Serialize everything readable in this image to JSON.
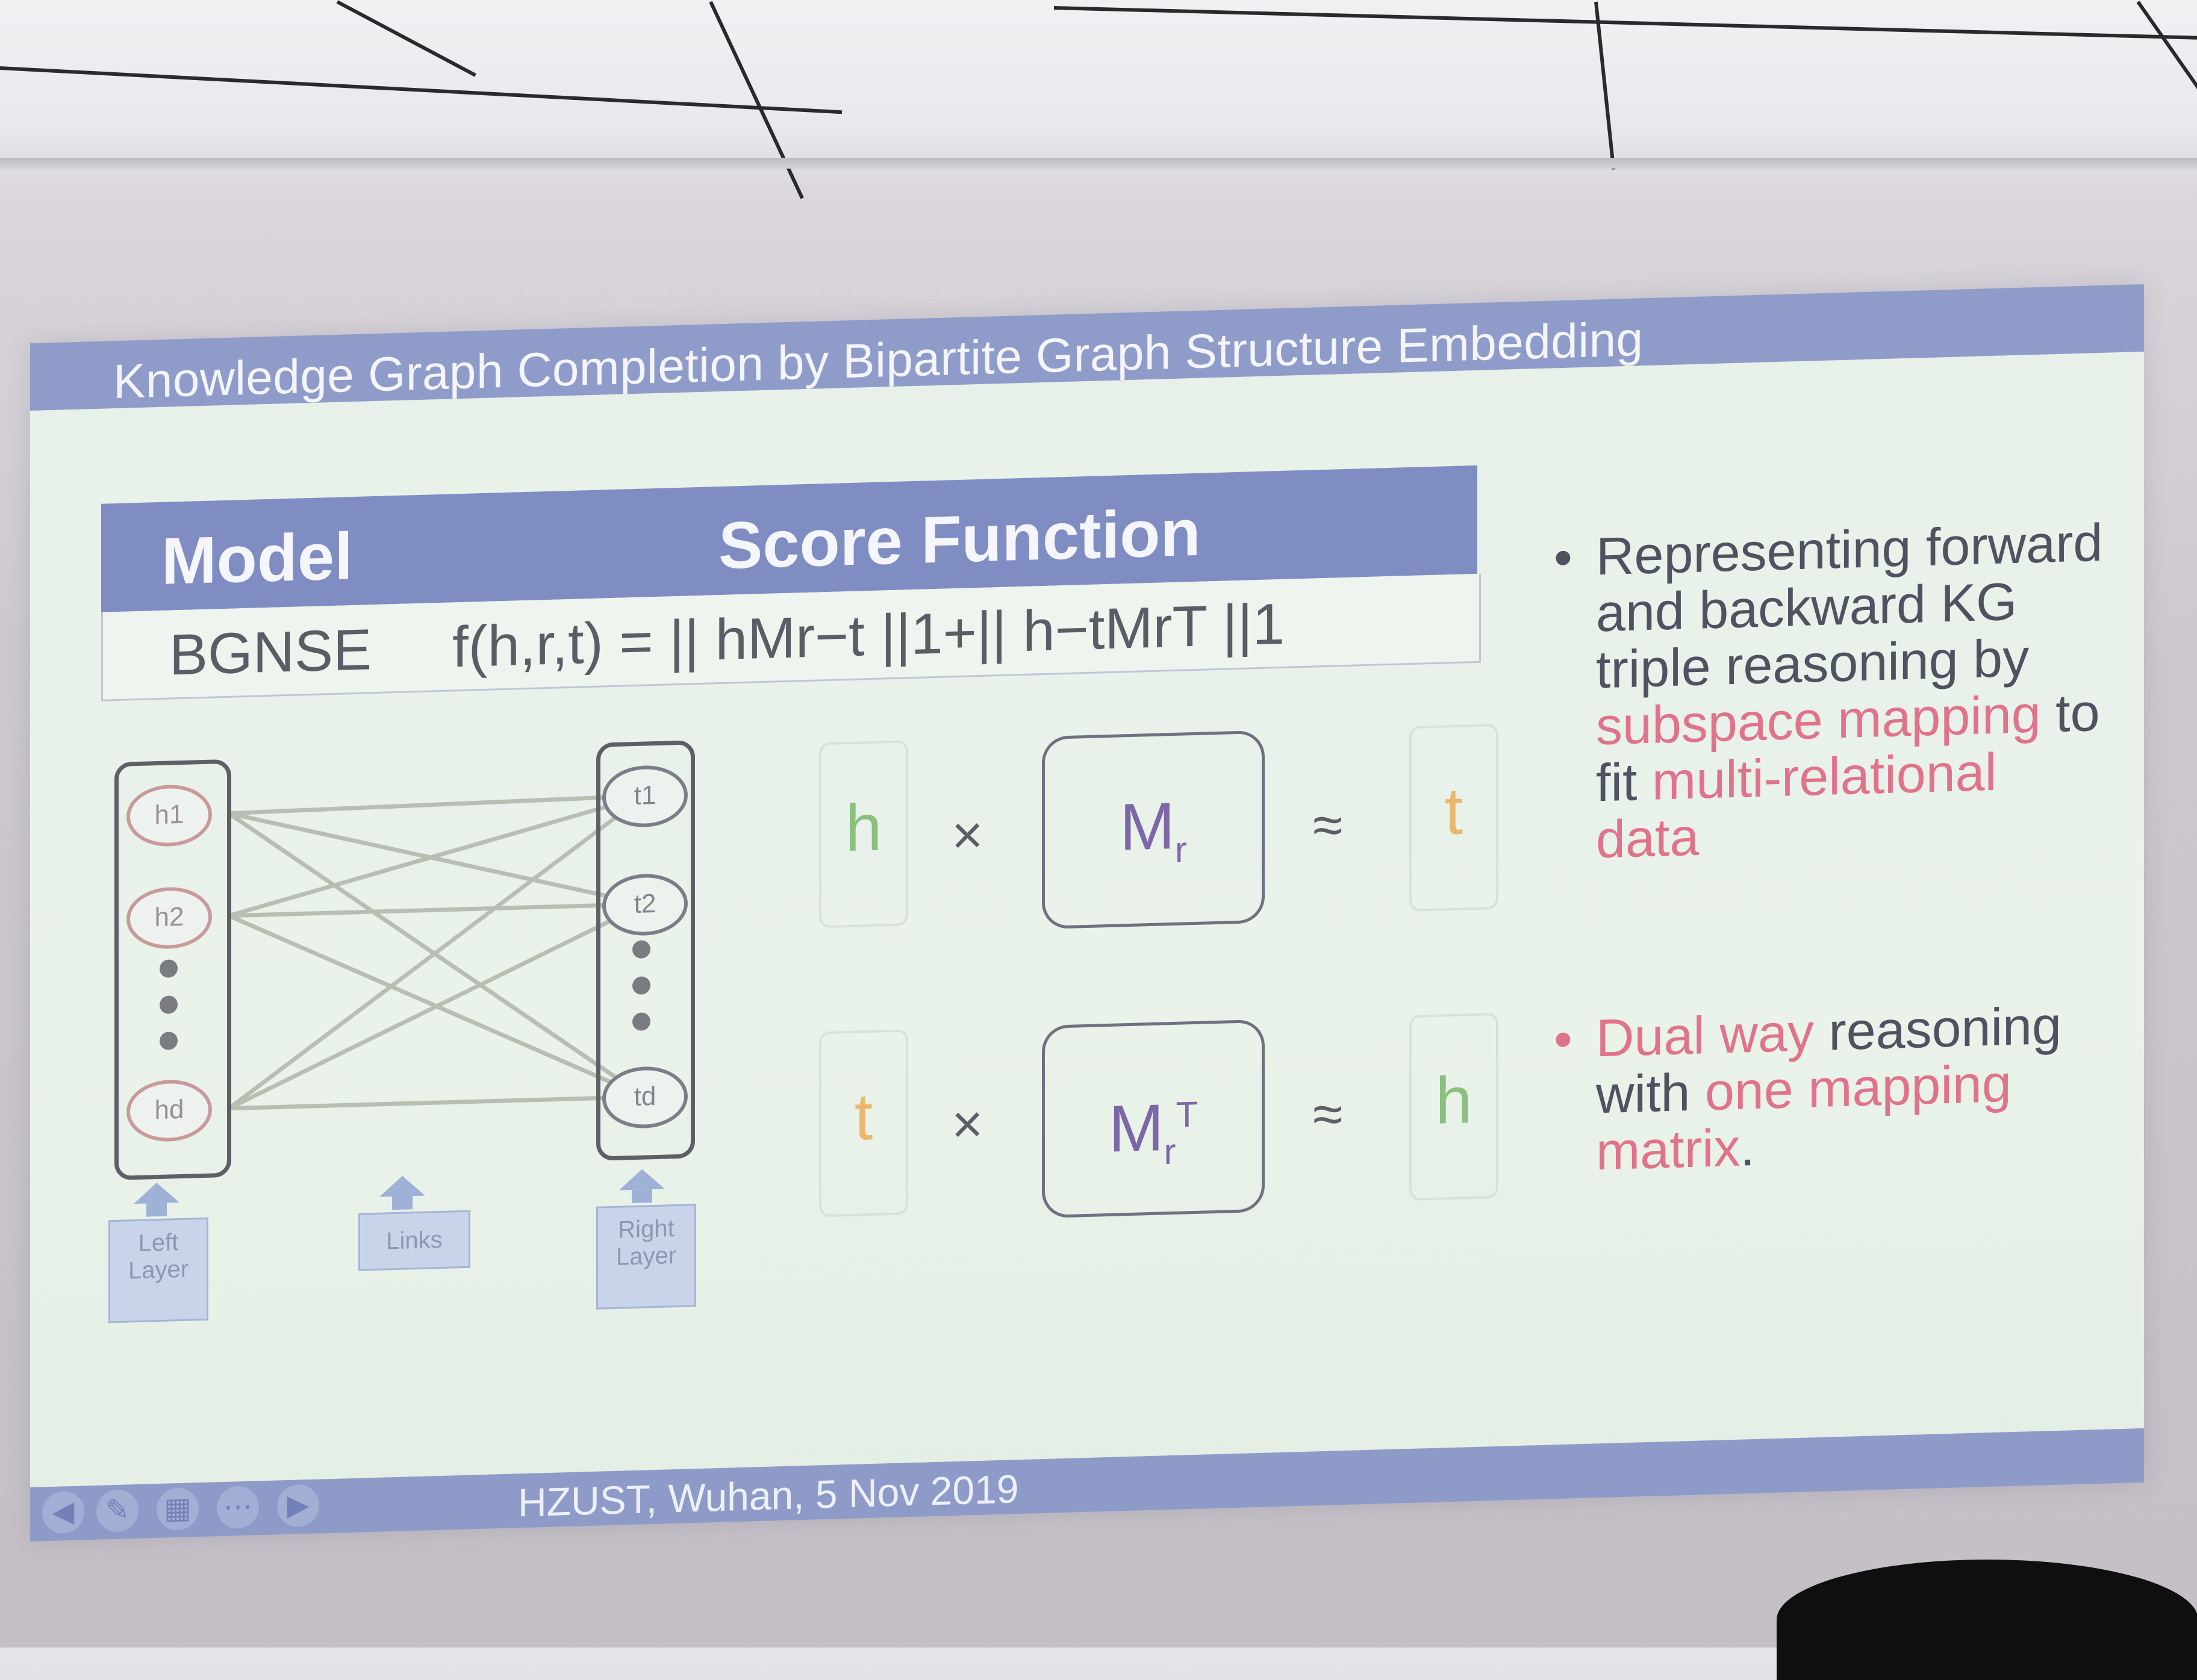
{
  "slide": {
    "title": "Knowledge Graph Completion by Bipartite Graph Structure Embedding",
    "table": {
      "headers": [
        "Model",
        "Score Function"
      ],
      "row": {
        "model": "BGNSE",
        "score_function": "f(h,r,t) = || hMr−t ||1+|| h−tMrT ||1"
      }
    },
    "graph": {
      "left_nodes": [
        "h1",
        "h2",
        "hd"
      ],
      "right_nodes": [
        "t1",
        "t2",
        "td"
      ],
      "labels": {
        "left": "Left Layer",
        "links": "Links",
        "right": "Right Layer"
      }
    },
    "equations": [
      {
        "left": "h",
        "op": "×",
        "matrix": "Mr",
        "approx": "≈",
        "right": "t"
      },
      {
        "left": "t",
        "op": "×",
        "matrix": "MrT",
        "approx": "≈",
        "right": "h"
      }
    ],
    "bullets": [
      {
        "plain_1": "Representing forward and backward KG triple reasoning by",
        "red_1": "subspace mapping",
        "plain_2": "to fit",
        "red_2": "multi-relational data"
      },
      {
        "red_1": "Dual way",
        "plain_1": "reasoning with",
        "red_2": "one mapping matrix",
        "plain_2": "."
      }
    ],
    "footer": "HZUST, Wuhan, 5 Nov 2019",
    "colors": {
      "title_bar": "#8f9cc9",
      "slide_bg": "#e7f1e9",
      "accent_red": "#e0738a",
      "h_green": "#8cc07f",
      "t_orange": "#e9b86c",
      "matrix_purple": "#7d67a6"
    },
    "control_icons": [
      "back-icon",
      "pen-icon",
      "slides-icon",
      "more-icon",
      "forward-icon"
    ]
  }
}
